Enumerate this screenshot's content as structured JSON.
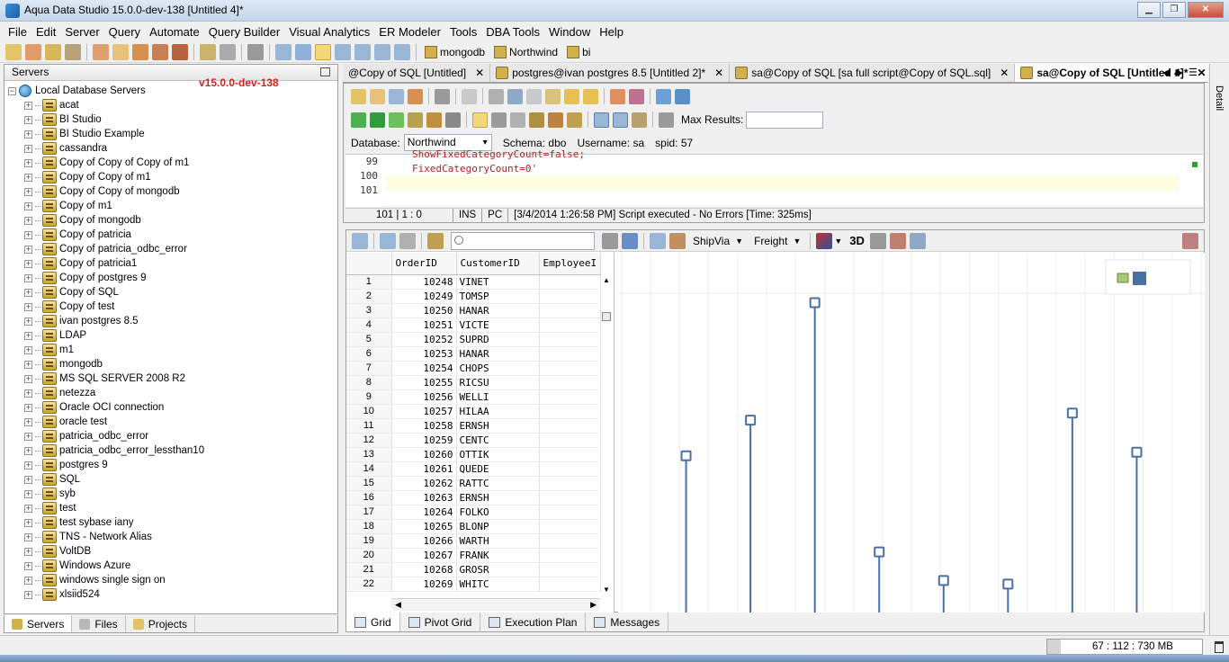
{
  "window": {
    "title": "Aqua Data Studio 15.0.0-dev-138 [Untitled 4]*",
    "buttons": [
      "minimize",
      "restore",
      "close"
    ]
  },
  "menu": [
    "File",
    "Edit",
    "Server",
    "Query",
    "Automate",
    "Query Builder",
    "Visual Analytics",
    "ER Modeler",
    "Tools",
    "DBA Tools",
    "Window",
    "Help"
  ],
  "toolbar": {
    "connections": [
      "mongodb",
      "Northwind",
      "bi"
    ]
  },
  "servers_panel": {
    "title": "Servers",
    "root": "Local Database Servers",
    "version_label": "v15.0.0-dev-138",
    "items": [
      "acat",
      "BI Studio",
      "BI Studio Example",
      "cassandra",
      "Copy of Copy of Copy of m1",
      "Copy of Copy of m1",
      "Copy of Copy of mongodb",
      "Copy of m1",
      "Copy of mongodb",
      "Copy of patricia",
      "Copy of patricia_odbc_error",
      "Copy of patricia1",
      "Copy of postgres 9",
      "Copy of SQL",
      "Copy of test",
      "ivan postgres 8.5",
      "LDAP",
      "m1",
      "mongodb",
      "MS SQL SERVER 2008 R2",
      "netezza",
      "Oracle OCI connection",
      "oracle test",
      "patricia_odbc_error",
      "patricia_odbc_error_lessthan10",
      "postgres 9",
      "SQL",
      "syb",
      "test",
      "test sybase iany",
      "TNS - Network Alias",
      "VoltDB",
      "Windows Azure",
      "windows single sign on",
      "xlsiid524"
    ],
    "tabs": [
      "Servers",
      "Files",
      "Projects"
    ]
  },
  "editor_tabs": [
    {
      "label": "@Copy of SQL [Untitled]",
      "active": false
    },
    {
      "label": "postgres@ivan postgres 8.5 [Untitled 2]*",
      "active": false
    },
    {
      "label": "sa@Copy of SQL [sa full script@Copy of SQL.sql]",
      "active": false
    },
    {
      "label": "sa@Copy of SQL [Untitled 4]*",
      "active": true
    }
  ],
  "side_panel": "Detail",
  "query": {
    "max_results_label": "Max Results:",
    "database_label": "Database:",
    "database": "Northwind",
    "schema_label": "Schema:",
    "schema": "dbo",
    "username_label": "Username:",
    "username": "sa",
    "spid_label": "spid:",
    "spid": "57",
    "line_numbers": [
      "99",
      "100",
      "101"
    ],
    "code_lines": [
      "ShowFixedCategoryCount=false;",
      "FixedCategoryCount=0'",
      ""
    ],
    "status": {
      "position": "101 | 1 : 0",
      "mode": "INS",
      "encoding": "PC",
      "message": "[3/4/2014 1:26:58 PM] Script executed - No Errors [Time: 325ms]"
    }
  },
  "results": {
    "dropdowns": [
      "ShipVia",
      "Freight"
    ],
    "mode_3d": "3D",
    "columns": [
      "OrderID",
      "CustomerID",
      "EmployeeI"
    ],
    "rows": [
      [
        "1",
        "10248",
        "VINET"
      ],
      [
        "2",
        "10249",
        "TOMSP"
      ],
      [
        "3",
        "10250",
        "HANAR"
      ],
      [
        "4",
        "10251",
        "VICTE"
      ],
      [
        "5",
        "10252",
        "SUPRD"
      ],
      [
        "6",
        "10253",
        "HANAR"
      ],
      [
        "7",
        "10254",
        "CHOPS"
      ],
      [
        "8",
        "10255",
        "RICSU"
      ],
      [
        "9",
        "10256",
        "WELLI"
      ],
      [
        "10",
        "10257",
        "HILAA"
      ],
      [
        "11",
        "10258",
        "ERNSH"
      ],
      [
        "12",
        "10259",
        "CENTC"
      ],
      [
        "13",
        "10260",
        "OTTIK"
      ],
      [
        "14",
        "10261",
        "QUEDE"
      ],
      [
        "15",
        "10262",
        "RATTC"
      ],
      [
        "16",
        "10263",
        "ERNSH"
      ],
      [
        "17",
        "10264",
        "FOLKO"
      ],
      [
        "18",
        "10265",
        "BLONP"
      ],
      [
        "19",
        "10266",
        "WARTH"
      ],
      [
        "20",
        "10267",
        "FRANK"
      ],
      [
        "21",
        "10268",
        "GROSR"
      ],
      [
        "22",
        "10269",
        "WHITC"
      ]
    ],
    "tabs": [
      "Grid",
      "Pivot Grid",
      "Execution Plan",
      "Messages"
    ]
  },
  "chart_data": {
    "type": "scatter",
    "title": "",
    "xlabel": "",
    "ylabel": "",
    "grid": true,
    "legend": "top-right",
    "color": "#4a6fa5",
    "points": [
      {
        "x": 1,
        "y": 0.44
      },
      {
        "x": 2,
        "y": 0.54
      },
      {
        "x": 3,
        "y": 0.87
      },
      {
        "x": 4,
        "y": 0.17
      },
      {
        "x": 5,
        "y": 0.09
      },
      {
        "x": 6,
        "y": 0.08
      },
      {
        "x": 7,
        "y": 0.56
      },
      {
        "x": 8,
        "y": 0.45
      }
    ],
    "xlim": [
      0,
      9
    ],
    "ylim": [
      0,
      1
    ]
  },
  "memory": "67 : 112 : 730 MB",
  "memory_used_fraction": 0.09
}
